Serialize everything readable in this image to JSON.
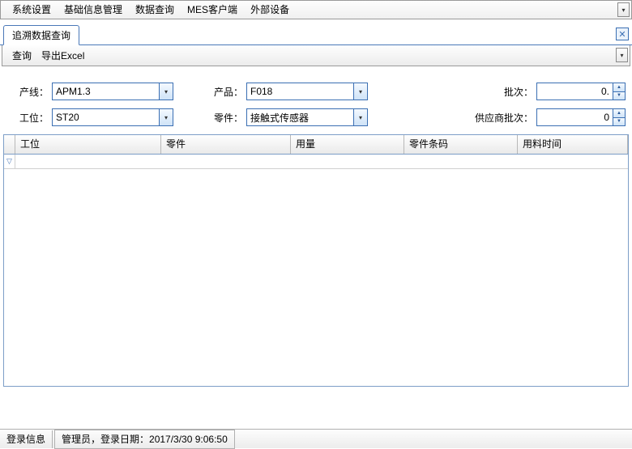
{
  "menubar": {
    "items": [
      "系统设置",
      "基础信息管理",
      "数据查询",
      "MES客户端",
      "外部设备"
    ]
  },
  "tab": {
    "title": "追溯数据查询"
  },
  "toolbar": {
    "query": "查询",
    "export": "导出Excel"
  },
  "form": {
    "line_label": "产线：",
    "line_value": "APM1.3",
    "product_label": "产品：",
    "product_value": "F018",
    "batch_label": "批次：",
    "batch_value": "0.",
    "station_label": "工位：",
    "station_value": "ST20",
    "part_label": "零件：",
    "part_value": "接触式传感器",
    "supplier_batch_label": "供应商批次：",
    "supplier_batch_value": "0"
  },
  "grid": {
    "columns": [
      "工位",
      "零件",
      "用量",
      "零件条码",
      "用料时间"
    ],
    "rows": []
  },
  "status": {
    "login_label": "登录信息",
    "login_text": "管理员，登录日期：2017/3/30 9:06:50"
  }
}
